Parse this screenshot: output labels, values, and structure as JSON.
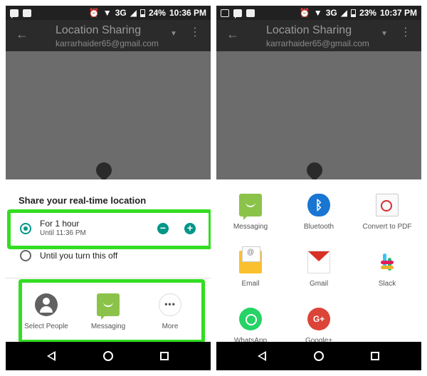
{
  "status_left": {
    "battery": "24%",
    "time": "10:36 PM",
    "network": "3G"
  },
  "status_right": {
    "battery": "23%",
    "time": "10:37 PM",
    "network": "3G"
  },
  "appbar": {
    "title": "Location Sharing",
    "subtitle": "karrarhaider65@gmail.com"
  },
  "sheet": {
    "title": "Share your real-time location",
    "options": [
      {
        "label": "For 1 hour",
        "sub": "Until 11:36 PM",
        "selected": true
      },
      {
        "label": "Until you turn this off",
        "selected": false
      }
    ],
    "apps": [
      {
        "label": "Select People",
        "icon": "person-icon"
      },
      {
        "label": "Messaging",
        "icon": "messaging-icon"
      },
      {
        "label": "More",
        "icon": "more-icon"
      }
    ]
  },
  "share_grid": [
    {
      "label": "Messaging",
      "icon": "messaging-icon"
    },
    {
      "label": "Bluetooth",
      "icon": "bluetooth-icon"
    },
    {
      "label": "Convert to PDF",
      "icon": "pdf-icon"
    },
    {
      "label": "Email",
      "icon": "email-icon"
    },
    {
      "label": "Gmail",
      "icon": "gmail-icon"
    },
    {
      "label": "Slack",
      "icon": "slack-icon"
    },
    {
      "label": "WhatsApp",
      "icon": "whatsapp-icon"
    },
    {
      "label": "Google+",
      "icon": "google-plus-icon"
    }
  ],
  "colors": {
    "accent": "#009688",
    "highlight": "#33dd22"
  }
}
